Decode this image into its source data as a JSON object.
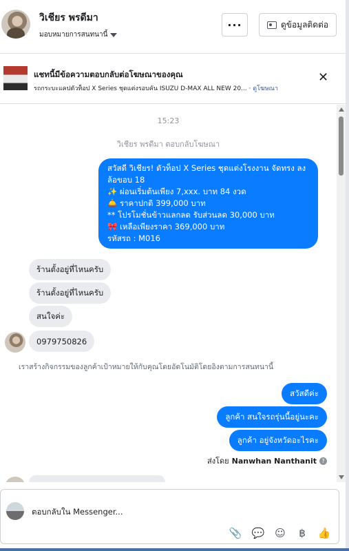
{
  "header": {
    "contact_name": "วิเชียร พรดีมา",
    "assign_label": "มอบหมายการสนทนานี้",
    "more_label": "···",
    "contact_info_label": "ดูข้อมูลติดต่อ"
  },
  "ad_banner": {
    "title": "แชทนี้มีข้อความตอบกลับต่อโฆษณาของคุณ",
    "subtitle": "รถกระบะแคปตัวท็อป X Series ชุดแต่งรอบคัน ISUZU D-MAX ALL NEW 20...",
    "link": "ดูโฆษณา",
    "close_label": "✕"
  },
  "chat": {
    "time": "15:23",
    "reply_note": "วิเชียร พรดีมา ตอบกลับโฆษณา",
    "ad_reply_lines": [
      "สวัสดี วิเชียร! ตัวท็อป X Series ชุดแต่งโรงงาน จัดทรง ลง",
      "ล้อขอบ 18",
      "✨  ผ่อนเริ่มต้นเพียง 7,xxx. บาท 84 งวด",
      "🛎️ ราคาปกติ 399,000 บาท",
      "** โปรโมชั่นข้าวแลกลด รับส่วนลด 30,000 บาท",
      "🎀  เหลือเพียงราคา 369,000 บาท",
      " รหัสรถ : M016"
    ],
    "incoming": [
      "ร้านตั้งอยู่ที่ไหนครับ",
      "ร้านตั้งอยู่ที่ไหนครับ",
      "สนใจค่ะ",
      "0979750826"
    ],
    "system_note": "เราสร้างกิจกรรมของลูกค้าเป้าหมายให้กับคุณโดยอัตโนมัติโดยอิงตามการสนทนานี้",
    "outgoing": [
      "สวัสดีค่ะ",
      "ลูกค้า สนใจรถรุ่นนี้อยู่นะคะ",
      "ลูกค้า อยู่จังหวัดอะไรคะ"
    ],
    "sent_by_prefix": "ส่งโดย",
    "sent_by_name": "Nanwhan Nanthanit"
  },
  "composer": {
    "placeholder": "ตอบกลับใน Messenger...",
    "tools": [
      "📎",
      "💬",
      "☺",
      "฿",
      "👍"
    ]
  },
  "colors": {
    "outgoing_bubble": "#0a7cff",
    "incoming_bubble": "#e9ebee",
    "link": "#385898"
  }
}
